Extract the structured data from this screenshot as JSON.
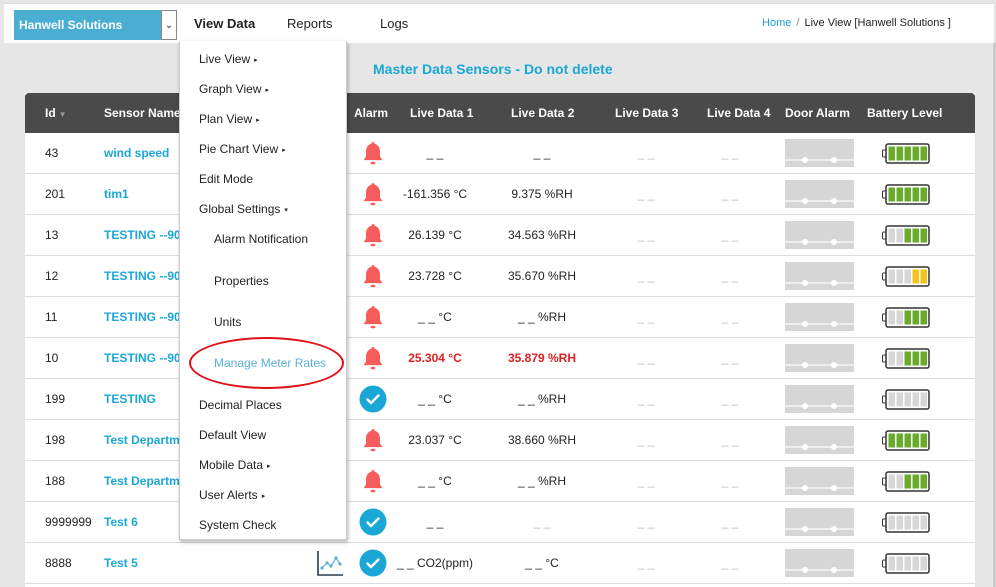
{
  "header": {
    "company_select": "Hanwell Solutions",
    "nav": [
      "View Data",
      "Reports",
      "Logs"
    ],
    "breadcrumb": {
      "home": "Home",
      "separator": "/",
      "current": "Live View [Hanwell Solutions ]"
    }
  },
  "page_title": "Master Data Sensors - Do not delete",
  "table": {
    "columns": [
      "Id",
      "Sensor Name",
      "Alarm",
      "Live Data 1",
      "Live Data 2",
      "Live Data 3",
      "Live Data 4",
      "Door Alarm",
      "Battery Level"
    ],
    "rows": [
      {
        "id": "43",
        "name": "wind speed",
        "alarm": "bell",
        "ld1": "_ _",
        "ld2": "_ _",
        "ld3": "_ _",
        "ld4": "_ _",
        "battery": 5,
        "battery_color": "green"
      },
      {
        "id": "201",
        "name": "tim1",
        "alarm": "bell",
        "ld1": "-161.356 °C",
        "ld2": "9.375 %RH",
        "ld3": "_ _",
        "ld4": "_ _",
        "battery": 5,
        "battery_color": "green"
      },
      {
        "id": "13",
        "name": "TESTING --90",
        "alarm": "bell",
        "ld1": "26.139 °C",
        "ld2": "34.563 %RH",
        "ld3": "_ _",
        "ld4": "_ _",
        "battery": 3,
        "battery_color": "green"
      },
      {
        "id": "12",
        "name": "TESTING --90",
        "alarm": "bell",
        "ld1": "23.728 °C",
        "ld2": "35.670 %RH",
        "ld3": "_ _",
        "ld4": "_ _",
        "battery": 2,
        "battery_color": "yellow"
      },
      {
        "id": "11",
        "name": "TESTING --90",
        "alarm": "bell",
        "ld1": "_ _ °C",
        "ld2": "_ _ %RH",
        "ld3": "_ _",
        "ld4": "_ _",
        "battery": 3,
        "battery_color": "green"
      },
      {
        "id": "10",
        "name": "TESTING --90",
        "alarm": "bell",
        "ld1": "25.304 °C",
        "ld2": "35.879 %RH",
        "ld3": "_ _",
        "ld4": "_ _",
        "battery": 3,
        "battery_color": "green",
        "highlight": true
      },
      {
        "id": "199",
        "name": "TESTING",
        "alarm": "ok",
        "ld1": "_ _ °C",
        "ld2": "_ _ %RH",
        "ld3": "_ _",
        "ld4": "_ _",
        "battery": 0,
        "battery_color": "green"
      },
      {
        "id": "198",
        "name": "Test Departm",
        "alarm": "bell",
        "ld1": "23.037 °C",
        "ld2": "38.660 %RH",
        "ld3": "_ _",
        "ld4": "_ _",
        "battery": 5,
        "battery_color": "green"
      },
      {
        "id": "188",
        "name": "Test Departm",
        "alarm": "bell",
        "ld1": "_ _ °C",
        "ld2": "_ _ %RH",
        "ld3": "_ _",
        "ld4": "_ _",
        "battery": 3,
        "battery_color": "green"
      },
      {
        "id": "9999999",
        "name": "Test 6",
        "alarm": "ok",
        "ld1": "_ _",
        "ld2": "_ _",
        "ld3": "_ _",
        "ld4": "_ _",
        "battery": 0,
        "battery_color": "green",
        "ld2_muted": true
      },
      {
        "id": "8888",
        "name": "Test 5",
        "alarm": "ok",
        "ld1": "_ _ CO2(ppm)",
        "ld2": "_ _ °C",
        "ld3": "_ _",
        "ld4": "_ _",
        "battery": 0,
        "battery_color": "green",
        "graph_icon": true
      }
    ]
  },
  "dropdown": {
    "items": [
      {
        "label": "Live View",
        "arrow": "▸"
      },
      {
        "label": "Graph View",
        "arrow": "▸"
      },
      {
        "label": "Plan View",
        "arrow": "▸"
      },
      {
        "label": "Pie Chart View",
        "arrow": "▸"
      },
      {
        "label": "Edit Mode"
      },
      {
        "label": "Global Settings",
        "arrow": "▾"
      },
      {
        "label": "Alarm Notification",
        "sub": true
      },
      {
        "label": "Properties",
        "sub": true
      },
      {
        "label": "Units",
        "sub": true
      },
      {
        "label": "Manage Meter Rates",
        "sub": true,
        "highlight": true
      },
      {
        "label": "Decimal Places"
      },
      {
        "label": "Default View"
      },
      {
        "label": "Mobile Data",
        "arrow": "▸"
      },
      {
        "label": "User Alerts",
        "arrow": "▸"
      },
      {
        "label": "System Check"
      }
    ]
  },
  "colors": {
    "accent": "#1aa7d6",
    "alarm_red": "#f75c5c",
    "ok_blue": "#1aa7d6",
    "battery_green": "#6aab2c",
    "battery_yellow": "#f2c318",
    "annotation_red": "#e0101a"
  }
}
